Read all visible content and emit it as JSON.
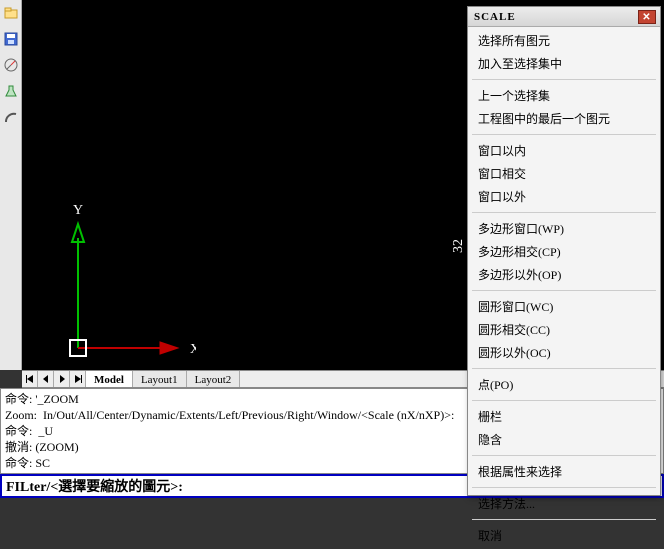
{
  "toolbar": {
    "icons": [
      "folder-icon",
      "save-icon",
      "compass-icon",
      "flask-icon",
      "arc-icon"
    ]
  },
  "viewport": {
    "ucs_x_label": "X",
    "ucs_y_label": "Y",
    "dim_text": "32"
  },
  "tabs": {
    "nav": [
      "« ",
      "‹",
      "›",
      " »"
    ],
    "items": [
      "Model",
      "Layout1",
      "Layout2"
    ],
    "active_index": 0
  },
  "command_log": [
    "命令: '_ZOOM",
    "Zoom:  In/Out/All/Center/Dynamic/Extents/Left/Previous/Right/Window/<Scale (nX/nXP)>:",
    "命令:  _U",
    "撤消: (ZOOM)",
    "命令: SC"
  ],
  "command_prompt": "FILter/<選擇要縮放的圖元>:",
  "context_menu": {
    "title": "SCALE",
    "groups": [
      [
        "选择所有图元",
        "加入至选择集中"
      ],
      [
        "上一个选择集",
        "工程图中的最后一个图元"
      ],
      [
        "窗口以内",
        "窗口相交",
        "窗口以外"
      ],
      [
        "多边形窗口(WP)",
        "多边形相交(CP)",
        "多边形以外(OP)"
      ],
      [
        "圆形窗口(WC)",
        "圆形相交(CC)",
        "圆形以外(OC)"
      ],
      [
        "点(PO)"
      ],
      [
        "栅栏",
        "隐含"
      ],
      [
        "根据属性来选择"
      ],
      [
        "选择方法..."
      ],
      [
        "取消"
      ]
    ]
  }
}
